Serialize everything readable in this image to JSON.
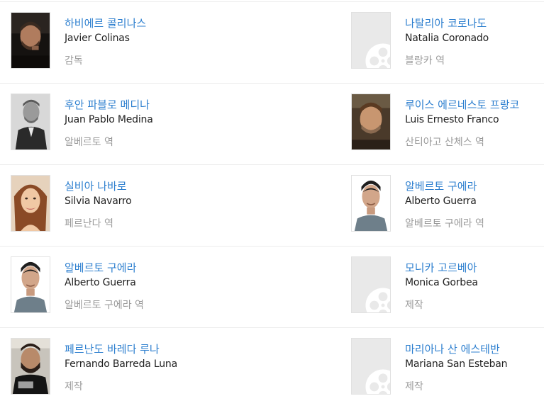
{
  "cast": [
    {
      "korean_name": "하비에르 콜리나스",
      "english_name": "Javier Colinas",
      "role": "감독",
      "photo": "portrait-javier-colinas"
    },
    {
      "korean_name": "나탈리아 코로나도",
      "english_name": "Natalia Coronado",
      "role": "블랑카 역",
      "photo": "placeholder-film-reel-icon"
    },
    {
      "korean_name": "후안 파블로 메디나",
      "english_name": "Juan Pablo Medina",
      "role": "알베르토 역",
      "photo": "portrait-juan-pablo-medina"
    },
    {
      "korean_name": "루이스 에르네스토 프랑코",
      "english_name": "Luis Ernesto Franco",
      "role": "산티아고 산체스 역",
      "photo": "portrait-luis-ernesto-franco"
    },
    {
      "korean_name": "실비아 나바로",
      "english_name": "Silvia Navarro",
      "role": "페르난다 역",
      "photo": "portrait-silvia-navarro"
    },
    {
      "korean_name": "알베르토 구에라",
      "english_name": "Alberto Guerra",
      "role": "알베르토 구에라 역",
      "photo": "portrait-alberto-guerra"
    },
    {
      "korean_name": "알베르토 구에라",
      "english_name": "Alberto Guerra",
      "role": "알베르토 구에라 역",
      "photo": "portrait-alberto-guerra"
    },
    {
      "korean_name": "모니카 고르베아",
      "english_name": "Monica Gorbea",
      "role": "제작",
      "photo": "placeholder-film-reel-icon"
    },
    {
      "korean_name": "페르난도 바레다 루나",
      "english_name": "Fernando Barreda Luna",
      "role": "제작",
      "photo": "portrait-fernando-barreda-luna"
    },
    {
      "korean_name": "마리아나 산 에스테반",
      "english_name": "Mariana San Esteban",
      "role": "제작",
      "photo": "placeholder-film-reel-icon"
    }
  ],
  "colors": {
    "name_link": "#2d7fcf",
    "english_name": "#222222",
    "role": "#9a9a9a",
    "divider": "#ececec",
    "placeholder_bg": "#e9e9e9"
  }
}
